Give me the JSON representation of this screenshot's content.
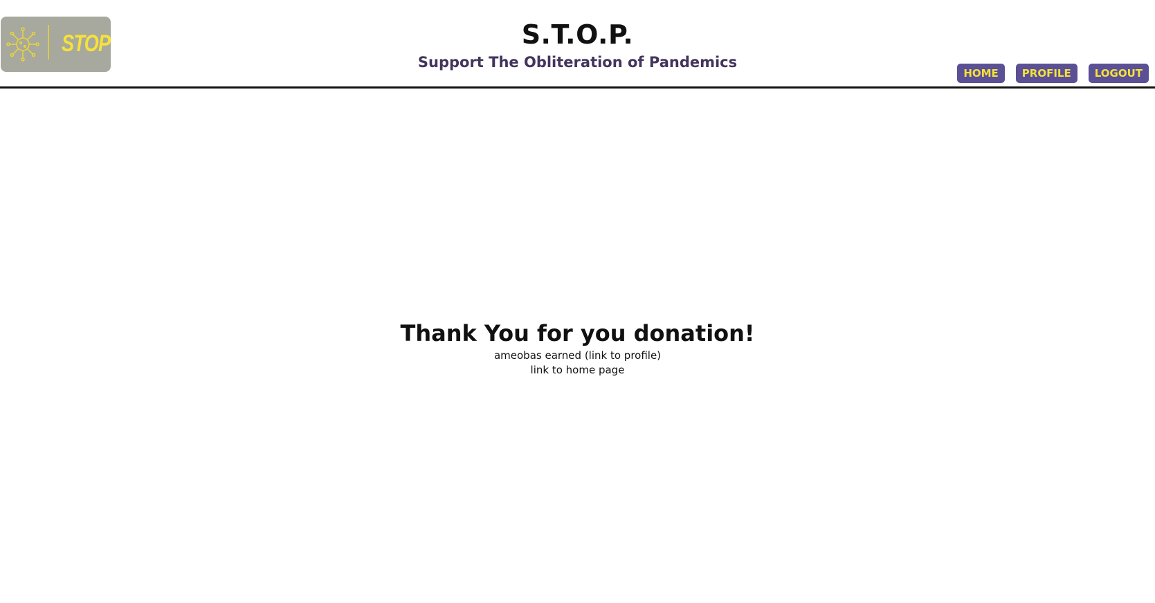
{
  "header": {
    "logo_text": "STOP",
    "title": "S.T.O.P.",
    "subtitle": "Support The Obliteration of Pandemics"
  },
  "nav": {
    "home": "HOME",
    "profile": "PROFILE",
    "logout": "LOGOUT"
  },
  "main": {
    "heading": "Thank You for you donation!",
    "ameobas_line": "ameobas earned (link to profile)",
    "home_link_line": "link to home page"
  },
  "colors": {
    "nav_bg": "#5b4f96",
    "nav_text": "#f5e23a",
    "logo_bg": "#a7a89e",
    "subtitle": "#43345c"
  },
  "icons": {
    "logo": "virus-icon"
  }
}
